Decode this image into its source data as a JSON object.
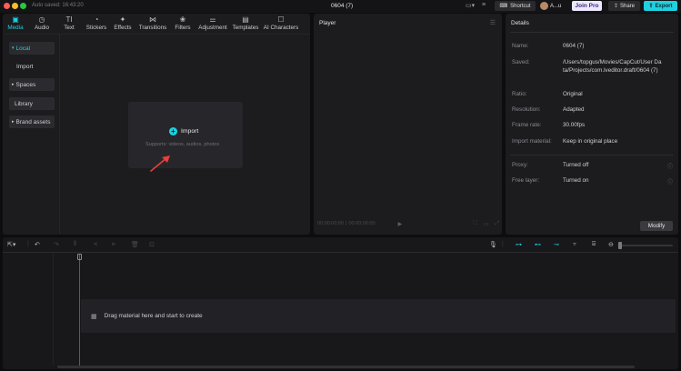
{
  "titlebar": {
    "autosave": "Auto saved: 16:43:20",
    "project_title": "0604 (7)",
    "shortcut_label": "Shortcut",
    "user_name": "A...u",
    "join_pro_label": "Join Pro",
    "share_label": "Share",
    "export_label": "Export"
  },
  "media": {
    "tabs": [
      {
        "label": "Media",
        "icon": "media-icon"
      },
      {
        "label": "Audio",
        "icon": "audio-icon"
      },
      {
        "label": "Text",
        "icon": "text-icon"
      },
      {
        "label": "Stickers",
        "icon": "stickers-icon"
      },
      {
        "label": "Effects",
        "icon": "effects-icon"
      },
      {
        "label": "Transitions",
        "icon": "transitions-icon"
      },
      {
        "label": "Filters",
        "icon": "filters-icon"
      },
      {
        "label": "Adjustment",
        "icon": "adjustment-icon"
      },
      {
        "label": "Templates",
        "icon": "templates-icon"
      },
      {
        "label": "AI Characters",
        "icon": "ai-characters-icon"
      }
    ],
    "sidebar": {
      "local": "Local",
      "import": "Import",
      "spaces": "Spaces",
      "library": "Library",
      "brand_assets": "Brand assets"
    },
    "import_box": {
      "label": "Import",
      "supports": "Supports: videos, audios, photos"
    }
  },
  "player": {
    "title": "Player",
    "current_time": "00:00:00:00",
    "total_time": "00:00:00:00"
  },
  "details": {
    "title": "Details",
    "rows": [
      {
        "label": "Name:",
        "value": "0604 (7)"
      },
      {
        "label": "Saved:",
        "value": "/Users/topgus/Movies/CapCut/User Data/Projects/com.lveditor.draft/0604 (7)"
      },
      {
        "label": "Ratio:",
        "value": "Original"
      },
      {
        "label": "Resolution:",
        "value": "Adapted"
      },
      {
        "label": "Frame rate:",
        "value": "30.00fps"
      },
      {
        "label": "Import material:",
        "value": "Keep in original place"
      }
    ],
    "proxy": {
      "label": "Proxy:",
      "value": "Turned off"
    },
    "free_layer": {
      "label": "Free layer:",
      "value": "Turned on"
    },
    "modify_label": "Modify"
  },
  "timeline": {
    "drop_hint": "Drag material here and start to create"
  },
  "colors": {
    "accent": "#1fd1e0",
    "join_pro_bg": "#ede8ff",
    "export_bg": "#1fd1e0"
  }
}
